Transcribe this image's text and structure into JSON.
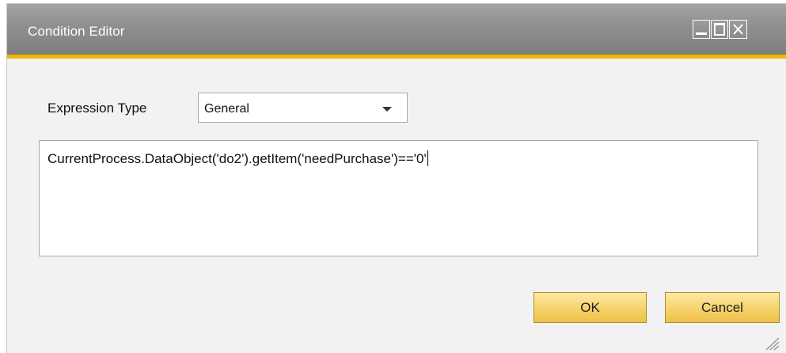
{
  "window": {
    "title": "Condition Editor",
    "controls": {
      "minimize_icon": "minimize-icon",
      "maximize_icon": "maximize-icon",
      "close_icon": "close-icon"
    },
    "accent_color": "#f2b600"
  },
  "form": {
    "expression_type_label": "Expression Type",
    "expression_type_value": "General",
    "expression_text": "CurrentProcess.DataObject('do2').getItem('needPurchase')=='0'"
  },
  "buttons": {
    "ok_label": "OK",
    "cancel_label": "Cancel"
  }
}
